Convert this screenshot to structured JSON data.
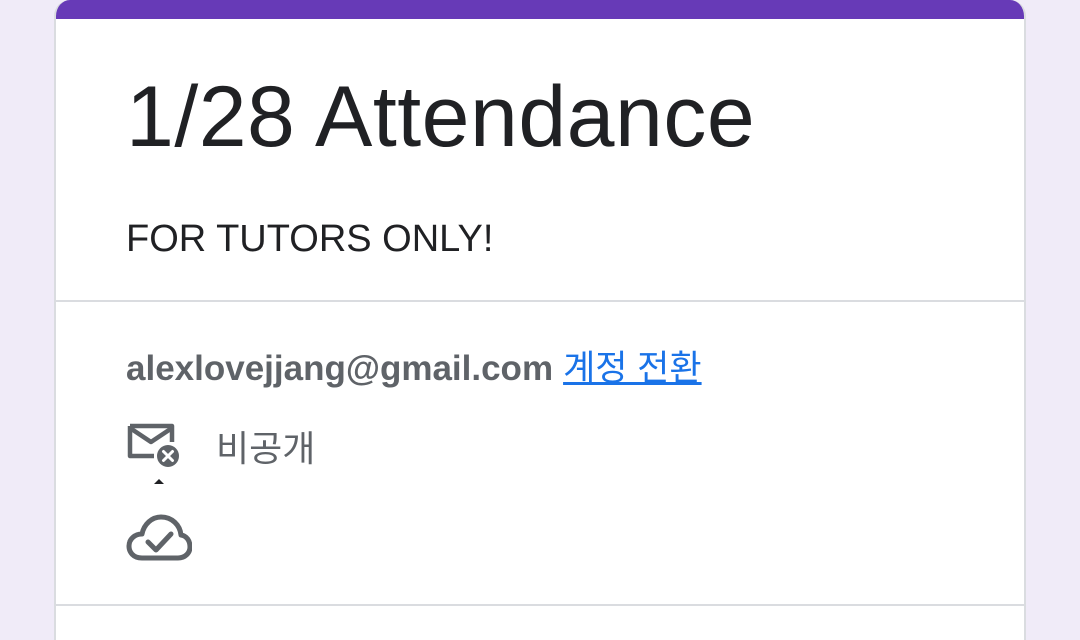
{
  "form": {
    "title": "1/28 Attendance",
    "description": "FOR TUTORS ONLY!"
  },
  "account": {
    "email": "alexlovejjang@gmail.com",
    "switch_label": "계정 전환",
    "email_privacy_label": "비공개",
    "email_privacy_icon": "mail-off-icon",
    "saved_status_icon": "cloud-done-icon"
  },
  "colors": {
    "accent": "#673ab7",
    "background": "#f0ebf8",
    "link": "#1a73e8",
    "text_primary": "#202124",
    "text_secondary": "#5f6368"
  }
}
